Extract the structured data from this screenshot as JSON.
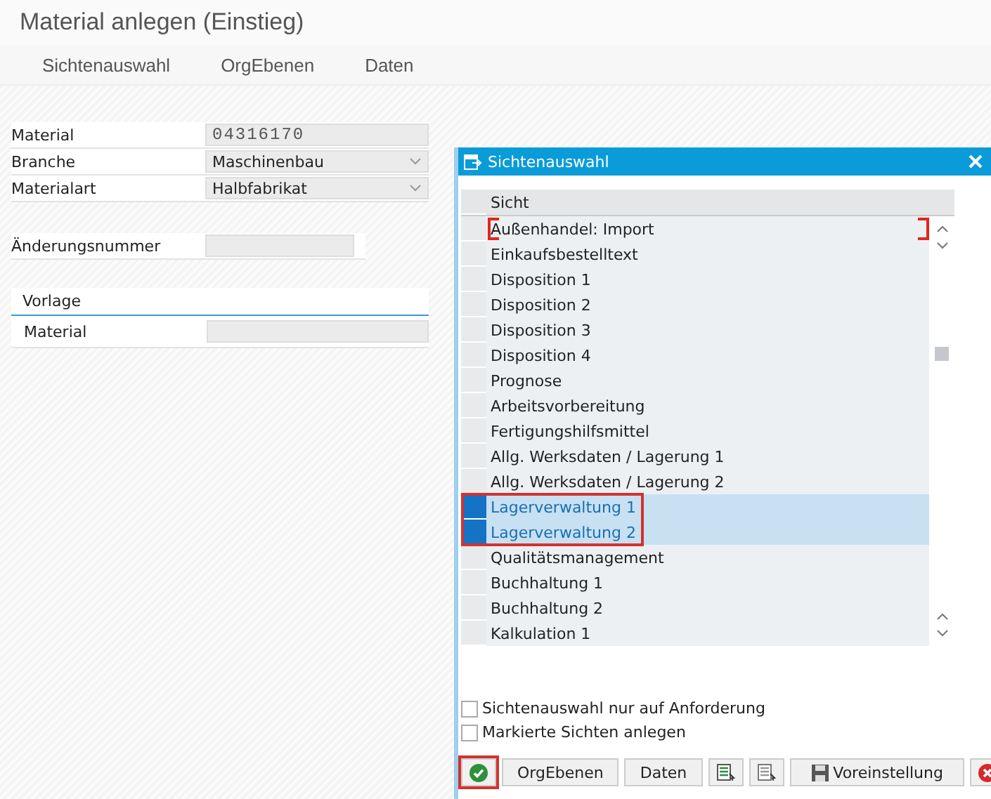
{
  "window": {
    "title": "Material anlegen (Einstieg)"
  },
  "toolbar": [
    "Sichtenauswahl",
    "OrgEbenen",
    "Daten"
  ],
  "form": {
    "fields": [
      {
        "label": "Material",
        "value": "04316170",
        "kind": "mono"
      },
      {
        "label": "Branche",
        "value": "Maschinenbau",
        "kind": "dropdown"
      },
      {
        "label": "Materialart",
        "value": "Halbfabrikat",
        "kind": "dropdown"
      }
    ],
    "change_number": {
      "label": "Änderungsnummer"
    },
    "template": {
      "title": "Vorlage",
      "field_label": "Material"
    }
  },
  "dialog": {
    "title": "Sichtenauswahl",
    "column": "Sicht",
    "rows": [
      {
        "label": "Außenhandel: Import",
        "selected": false,
        "focused": true
      },
      {
        "label": "Einkaufsbestelltext",
        "selected": false,
        "focused": false
      },
      {
        "label": "Disposition 1",
        "selected": false,
        "focused": false
      },
      {
        "label": "Disposition 2",
        "selected": false,
        "focused": false
      },
      {
        "label": "Disposition 3",
        "selected": false,
        "focused": false
      },
      {
        "label": "Disposition 4",
        "selected": false,
        "focused": false
      },
      {
        "label": "Prognose",
        "selected": false,
        "focused": false
      },
      {
        "label": "Arbeitsvorbereitung",
        "selected": false,
        "focused": false
      },
      {
        "label": "Fertigungshilfsmittel",
        "selected": false,
        "focused": false
      },
      {
        "label": "Allg. Werksdaten / Lagerung 1",
        "selected": false,
        "focused": false
      },
      {
        "label": "Allg. Werksdaten / Lagerung 2",
        "selected": false,
        "focused": false
      },
      {
        "label": "Lagerverwaltung 1",
        "selected": true,
        "focused": false
      },
      {
        "label": "Lagerverwaltung 2",
        "selected": true,
        "focused": false
      },
      {
        "label": "Qualitätsmanagement",
        "selected": false,
        "focused": false
      },
      {
        "label": "Buchhaltung 1",
        "selected": false,
        "focused": false
      },
      {
        "label": "Buchhaltung 2",
        "selected": false,
        "focused": false
      },
      {
        "label": "Kalkulation 1",
        "selected": false,
        "focused": false
      }
    ],
    "checkboxes": [
      {
        "label": "Sichtenauswahl nur auf Anforderung",
        "checked": false
      },
      {
        "label": "Markierte Sichten anlegen",
        "checked": false
      }
    ],
    "buttons": [
      {
        "kind": "confirm"
      },
      {
        "kind": "text",
        "label": "OrgEbenen"
      },
      {
        "kind": "text",
        "label": "Daten"
      },
      {
        "kind": "select-all"
      },
      {
        "kind": "deselect-all"
      },
      {
        "kind": "save",
        "label": "Voreinstellung"
      },
      {
        "kind": "cancel"
      }
    ]
  }
}
